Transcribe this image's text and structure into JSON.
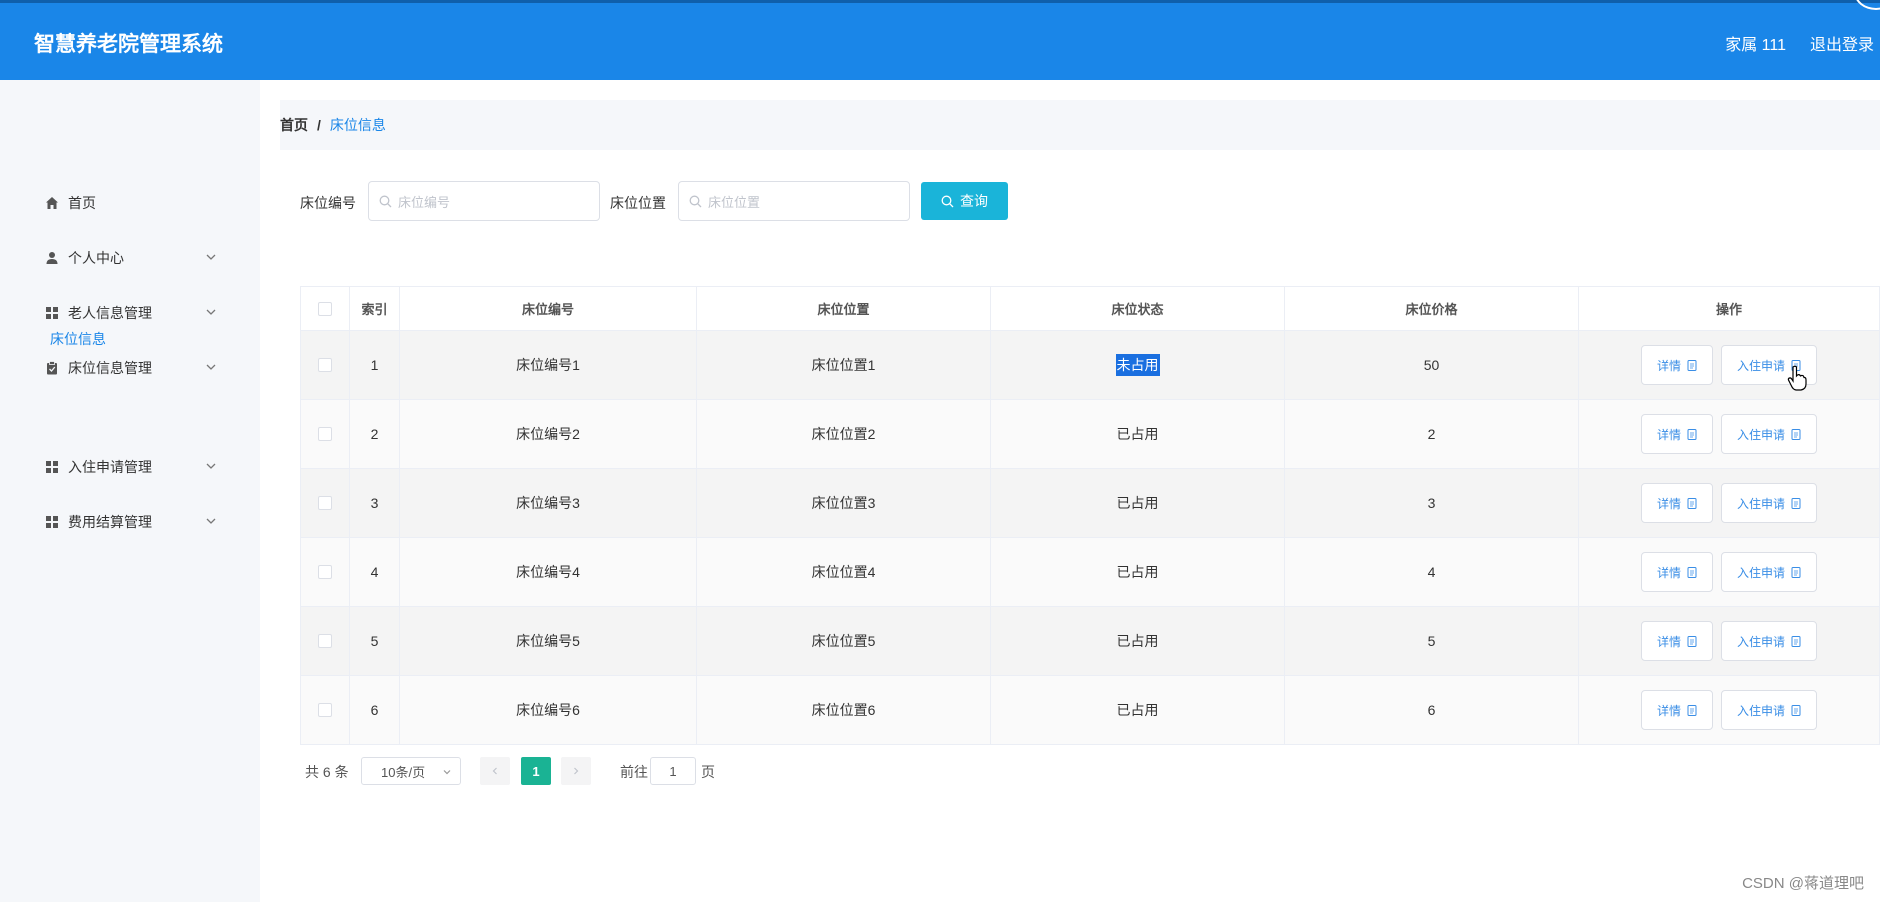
{
  "app": {
    "title": "智慧养老院管理系统",
    "user": "家属 111",
    "logout": "退出登录"
  },
  "sidebar": {
    "items": [
      {
        "label": "首页",
        "icon": "home-icon"
      },
      {
        "label": "个人中心",
        "icon": "user-icon"
      },
      {
        "label": "老人信息管理",
        "icon": "grid-icon"
      },
      {
        "label": "床位信息管理",
        "icon": "clipboard-icon"
      },
      {
        "label": "入住申请管理",
        "icon": "grid-icon"
      },
      {
        "label": "费用结算管理",
        "icon": "grid-icon"
      }
    ],
    "sub_item": "床位信息"
  },
  "breadcrumb": {
    "home": "首页",
    "sep": "/",
    "current": "床位信息"
  },
  "search": {
    "field1_label": "床位编号",
    "field1_placeholder": "床位编号",
    "field2_label": "床位位置",
    "field2_placeholder": "床位位置",
    "button": "查询"
  },
  "table": {
    "headers": [
      "索引",
      "床位编号",
      "床位位置",
      "床位状态",
      "床位价格",
      "操作"
    ],
    "rows": [
      {
        "index": "1",
        "bed_no": "床位编号1",
        "location": "床位位置1",
        "status": "未占用",
        "price": "50"
      },
      {
        "index": "2",
        "bed_no": "床位编号2",
        "location": "床位位置2",
        "status": "已占用",
        "price": "2"
      },
      {
        "index": "3",
        "bed_no": "床位编号3",
        "location": "床位位置3",
        "status": "已占用",
        "price": "3"
      },
      {
        "index": "4",
        "bed_no": "床位编号4",
        "location": "床位位置4",
        "status": "已占用",
        "price": "4"
      },
      {
        "index": "5",
        "bed_no": "床位编号5",
        "location": "床位位置5",
        "status": "已占用",
        "price": "5"
      },
      {
        "index": "6",
        "bed_no": "床位编号6",
        "location": "床位位置6",
        "status": "已占用",
        "price": "6"
      }
    ],
    "detail_label": "详情",
    "apply_label": "入住申请"
  },
  "pagination": {
    "total": "共 6 条",
    "page_size": "10条/页",
    "current_page": "1",
    "goto_label": "前往",
    "goto_value": "1",
    "page_unit": "页"
  },
  "watermark": "CSDN @蒋道理吧",
  "colors": {
    "header": "#1a86e8",
    "query_button": "#1ab4d9",
    "active_page": "#1ab394",
    "link": "#1a86e8"
  }
}
